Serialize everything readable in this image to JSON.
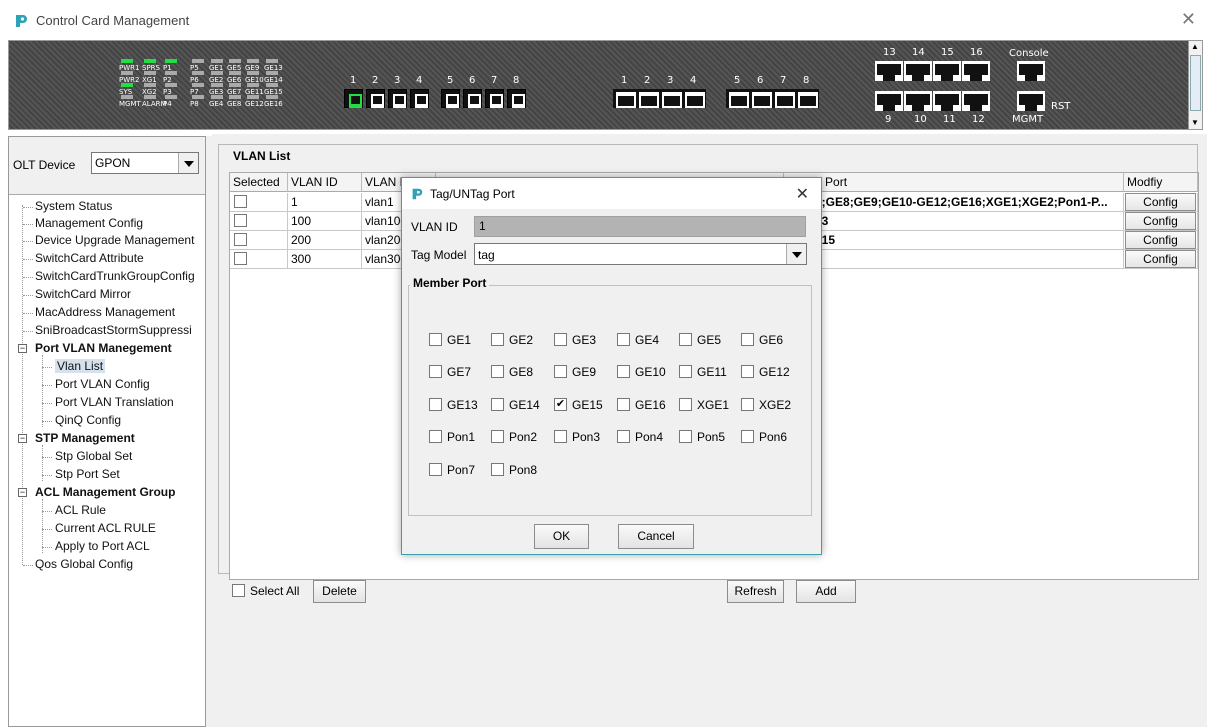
{
  "app": {
    "title": "Control Card Management"
  },
  "device": {
    "leds": [
      {
        "label": "PWR1",
        "on": true
      },
      {
        "label": "SPRS",
        "on": true
      },
      {
        "label": "P1",
        "on": true
      },
      {
        "label": "PWR2",
        "on": false
      },
      {
        "label": "XG1",
        "on": false
      },
      {
        "label": "P2",
        "on": false
      },
      {
        "label": "SYS",
        "on": true
      },
      {
        "label": "XG2",
        "on": false
      },
      {
        "label": "P3",
        "on": false
      },
      {
        "label": "MGMT",
        "on": false
      },
      {
        "label": "ALARM",
        "on": false
      },
      {
        "label": "P4",
        "on": false
      },
      {
        "label": "P5",
        "on": false
      },
      {
        "label": "P6",
        "on": false
      },
      {
        "label": "P7",
        "on": false
      },
      {
        "label": "P8",
        "on": false
      },
      {
        "label": "GE1",
        "on": false
      },
      {
        "label": "GE5",
        "on": false
      },
      {
        "label": "GE9",
        "on": false
      },
      {
        "label": "GE13",
        "on": false
      },
      {
        "label": "GE2",
        "on": false
      },
      {
        "label": "GE6",
        "on": false
      },
      {
        "label": "GE10",
        "on": false
      },
      {
        "label": "GE14",
        "on": false
      },
      {
        "label": "GE3",
        "on": false
      },
      {
        "label": "GE7",
        "on": false
      },
      {
        "label": "GE11",
        "on": false
      },
      {
        "label": "GE15",
        "on": false
      },
      {
        "label": "GE4",
        "on": false
      },
      {
        "label": "GE8",
        "on": false
      },
      {
        "label": "GE12",
        "on": false
      },
      {
        "label": "GE16",
        "on": false
      }
    ],
    "sfp_group_a": [
      "1",
      "2",
      "3",
      "4"
    ],
    "sfp_group_b": [
      "5",
      "6",
      "7",
      "8"
    ],
    "rj_group_a": [
      "1",
      "2",
      "3",
      "4"
    ],
    "rj_group_b": [
      "5",
      "6",
      "7",
      "8"
    ],
    "uplink_top": [
      "13",
      "14",
      "15",
      "16"
    ],
    "uplink_bottom": [
      "9",
      "10",
      "11",
      "12"
    ],
    "console_label": "Console",
    "mgmt_label": "MGMT",
    "rst_label": "RST"
  },
  "left": {
    "olt_label": "OLT Device",
    "olt_value": "GPON",
    "tree": [
      {
        "label": "System Status"
      },
      {
        "label": "Management Config"
      },
      {
        "label": "Device Upgrade Management"
      },
      {
        "label": "SwitchCard Attribute"
      },
      {
        "label": "SwitchCardTrunkGroupConfig"
      },
      {
        "label": "SwitchCard Mirror"
      },
      {
        "label": "MacAddress Management"
      },
      {
        "label": "SniBroadcastStormSuppressi"
      },
      {
        "label": "Port VLAN Manegement"
      },
      {
        "label": "Vlan List"
      },
      {
        "label": "Port VLAN Config"
      },
      {
        "label": "Port VLAN Translation"
      },
      {
        "label": "QinQ Config"
      },
      {
        "label": "STP Management"
      },
      {
        "label": "Stp Global Set"
      },
      {
        "label": "Stp Port Set"
      },
      {
        "label": "ACL Management Group"
      },
      {
        "label": "ACL Rule"
      },
      {
        "label": "Current ACL RULE"
      },
      {
        "label": "Apply to Port ACL"
      },
      {
        "label": "Qos Global Config"
      }
    ]
  },
  "vlan_list": {
    "title": "VLAN List",
    "columns": [
      "Selected",
      "VLAN ID",
      "VLAN Name",
      "Tag Port",
      "UnTag Port",
      "Modfiy"
    ],
    "rows": [
      {
        "id": "1",
        "name": "vlan1",
        "tag": "",
        "untag": "5;GE6;GE8;GE9;GE10-GE12;GE16;XGE1;XGE2;Pon1-P...",
        "modify": "Config"
      },
      {
        "id": "100",
        "name": "vlan100",
        "tag": "",
        "untag": "7;GE13",
        "modify": "Config"
      },
      {
        "id": "200",
        "name": "vlan200",
        "tag": "",
        "untag": "14;GE15",
        "modify": "Config"
      },
      {
        "id": "300",
        "name": "vlan300",
        "tag": "",
        "untag": "",
        "modify": "Config"
      }
    ],
    "select_all_label": "Select All",
    "delete_label": "Delete",
    "refresh_label": "Refresh",
    "add_label": "Add"
  },
  "dialog": {
    "title": "Tag/UNTag Port",
    "vlan_id_label": "VLAN ID",
    "vlan_id_value": "1",
    "tag_model_label": "Tag Model",
    "tag_model_value": "tag",
    "member_port_title": "Member Port",
    "ports": [
      [
        {
          "label": "GE1",
          "checked": false
        },
        {
          "label": "GE2",
          "checked": false
        },
        {
          "label": "GE3",
          "checked": false
        },
        {
          "label": "GE4",
          "checked": false
        },
        {
          "label": "GE5",
          "checked": false
        },
        {
          "label": "GE6",
          "checked": false
        }
      ],
      [
        {
          "label": "GE7",
          "checked": false
        },
        {
          "label": "GE8",
          "checked": false
        },
        {
          "label": "GE9",
          "checked": false
        },
        {
          "label": "GE10",
          "checked": false
        },
        {
          "label": "GE11",
          "checked": false
        },
        {
          "label": "GE12",
          "checked": false
        }
      ],
      [
        {
          "label": "GE13",
          "checked": false
        },
        {
          "label": "GE14",
          "checked": false
        },
        {
          "label": "GE15",
          "checked": true
        },
        {
          "label": "GE16",
          "checked": false
        },
        {
          "label": "XGE1",
          "checked": false
        },
        {
          "label": "XGE2",
          "checked": false
        }
      ],
      [
        {
          "label": "Pon1",
          "checked": false
        },
        {
          "label": "Pon2",
          "checked": false
        },
        {
          "label": "Pon3",
          "checked": false
        },
        {
          "label": "Pon4",
          "checked": false
        },
        {
          "label": "Pon5",
          "checked": false
        },
        {
          "label": "Pon6",
          "checked": false
        }
      ],
      [
        {
          "label": "Pon7",
          "checked": false
        },
        {
          "label": "Pon8",
          "checked": false
        }
      ]
    ],
    "ok_label": "OK",
    "cancel_label": "Cancel"
  },
  "colors": {
    "accent": "#3aa0b0",
    "led_on": "#22dd44",
    "selection": "#d6e1ee"
  }
}
